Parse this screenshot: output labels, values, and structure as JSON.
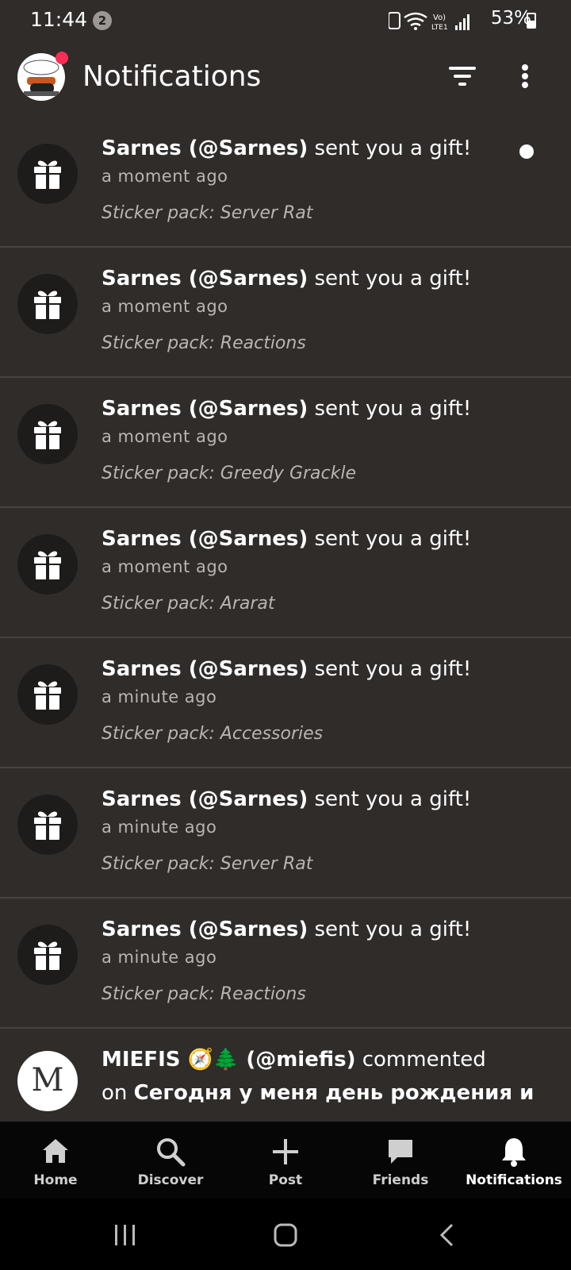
{
  "status_bar": {
    "time": "11:44",
    "notification_count": "2",
    "battery": "53%",
    "icons": [
      "sync-icon",
      "wifi-icon",
      "volte-icon",
      "signal-icon",
      "battery-icon"
    ]
  },
  "header": {
    "title": "Notifications",
    "icons": [
      "filter-icon",
      "more-vertical-icon"
    ]
  },
  "notifications": [
    {
      "user": "Sarnes (@Sarnes)",
      "action": " sent you a gift!",
      "time": "a moment ago",
      "detail": "Sticker pack: Server Rat",
      "unread": true,
      "icon": "gift-icon"
    },
    {
      "user": "Sarnes (@Sarnes)",
      "action": " sent you a gift!",
      "time": "a moment ago",
      "detail": "Sticker pack: Reactions",
      "unread": false,
      "icon": "gift-icon"
    },
    {
      "user": "Sarnes (@Sarnes)",
      "action": " sent you a gift!",
      "time": "a moment ago",
      "detail": "Sticker pack: Greedy Grackle",
      "unread": false,
      "icon": "gift-icon"
    },
    {
      "user": "Sarnes (@Sarnes)",
      "action": " sent you a gift!",
      "time": "a moment ago",
      "detail": "Sticker pack: Ararat",
      "unread": false,
      "icon": "gift-icon"
    },
    {
      "user": "Sarnes (@Sarnes)",
      "action": " sent you a gift!",
      "time": "a minute ago",
      "detail": "Sticker pack: Accessories",
      "unread": false,
      "icon": "gift-icon"
    },
    {
      "user": "Sarnes (@Sarnes)",
      "action": " sent you a gift!",
      "time": "a minute ago",
      "detail": "Sticker pack: Server Rat",
      "unread": false,
      "icon": "gift-icon"
    },
    {
      "user": "Sarnes (@Sarnes)",
      "action": " sent you a gift!",
      "time": "a minute ago",
      "detail": "Sticker pack: Reactions",
      "unread": false,
      "icon": "gift-icon"
    }
  ],
  "comment_notification": {
    "avatar_letter": "M",
    "user": "MIEFIS 🧭🌲 (@miefis)",
    "action": " commented",
    "on_text": "on ",
    "post_title": "Сегодня у меня день рождения и"
  },
  "bottom_nav": [
    {
      "label": "Home",
      "icon": "home-icon"
    },
    {
      "label": "Discover",
      "icon": "search-icon"
    },
    {
      "label": "Post",
      "icon": "plus-icon"
    },
    {
      "label": "Friends",
      "icon": "chat-icon"
    },
    {
      "label": "Notifications",
      "icon": "bell-icon",
      "active": true
    }
  ],
  "colors": {
    "background": "#2f2c2a",
    "divider": "#474340",
    "avatar_badge": "#ff2d55",
    "nav_background": "#060606"
  }
}
